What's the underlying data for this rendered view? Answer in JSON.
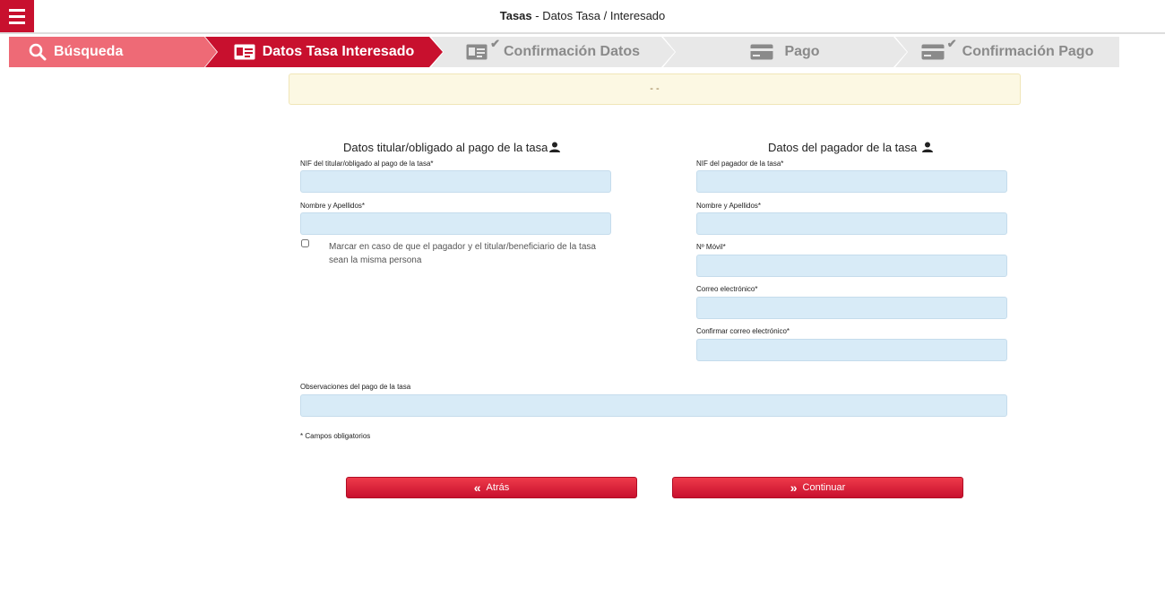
{
  "header": {
    "title_bold": "Tasas",
    "title_rest": " - Datos Tasa / Interesado"
  },
  "stepper": {
    "steps": [
      {
        "label": "Búsqueda",
        "icon": "search-icon",
        "state": "done"
      },
      {
        "label": "Datos Tasa Interesado",
        "icon": "id-card-icon",
        "state": "active"
      },
      {
        "label": "Confirmación Datos",
        "icon": "id-card-check-icon",
        "state": "pending"
      },
      {
        "label": "Pago",
        "icon": "credit-card-icon",
        "state": "pending"
      },
      {
        "label": "Confirmación Pago",
        "icon": "credit-card-check-icon",
        "state": "pending"
      }
    ]
  },
  "alert": {
    "text": "- -"
  },
  "titular": {
    "title": "Datos titular/obligado al pago de la tasa",
    "nif_label": "NIF del titular/obligado al pago de la tasa*",
    "nif_value": "",
    "nombre_label": "Nombre y Apellidos*",
    "nombre_value": "",
    "checkbox_label": "Marcar en caso de que el pagador y el titular/beneficiario de la tasa sean la misma persona"
  },
  "pagador": {
    "title": "Datos del pagador de la tasa",
    "nif_label": "NIF del pagador de la tasa*",
    "nombre_label": "Nombre y Apellidos*",
    "movil_label": "Nº Móvil*",
    "email_label": "Correo electrónico*",
    "email_confirm_label": "Confirmar correo electrónico*"
  },
  "observaciones": {
    "label": "Observaciones del pago de la tasa"
  },
  "required_note": "* Campos obligatorios",
  "buttons": {
    "back": "Atrás",
    "continue": "Continuar"
  },
  "colors": {
    "primary": "#c8102e",
    "step_done": "#ee6a76",
    "step_pending": "#e8e8e8",
    "input_bg": "#d8ebf7",
    "alert_bg": "#fcf8e3"
  }
}
